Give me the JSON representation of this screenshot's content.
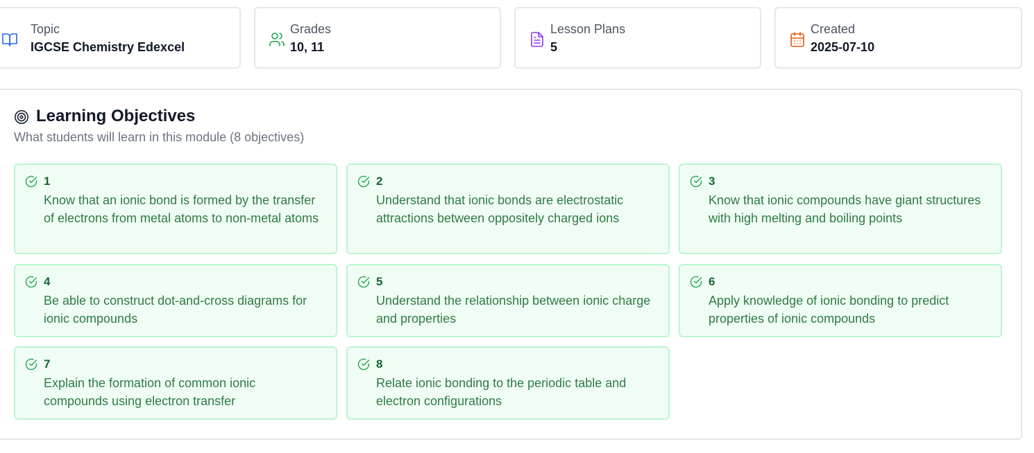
{
  "stats": [
    {
      "label": "Topic",
      "value": "IGCSE Chemistry Edexcel",
      "icon": "book-open-icon",
      "color": "#2563eb"
    },
    {
      "label": "Grades",
      "value": "10, 11",
      "icon": "users-icon",
      "color": "#16a34a"
    },
    {
      "label": "Lesson Plans",
      "value": "5",
      "icon": "file-text-icon",
      "color": "#9333ea"
    },
    {
      "label": "Created",
      "value": "2025-07-10",
      "icon": "calendar-icon",
      "color": "#ea580c"
    }
  ],
  "objectives": {
    "title": "Learning Objectives",
    "subtitle": "What students will learn in this module (8 objectives)",
    "icon": "target-icon",
    "items": [
      {
        "number": "1",
        "text": "Know that an ionic bond is formed by the transfer of electrons from metal atoms to non-metal atoms"
      },
      {
        "number": "2",
        "text": "Understand that ionic bonds are electrostatic attractions between oppositely charged ions"
      },
      {
        "number": "3",
        "text": "Know that ionic compounds have giant structures with high melting and boiling points"
      },
      {
        "number": "4",
        "text": "Be able to construct dot-and-cross diagrams for ionic compounds"
      },
      {
        "number": "5",
        "text": "Understand the relationship between ionic charge and properties"
      },
      {
        "number": "6",
        "text": "Apply knowledge of ionic bonding to predict properties of ionic compounds"
      },
      {
        "number": "7",
        "text": "Explain the formation of common ionic compounds using electron transfer"
      },
      {
        "number": "8",
        "text": "Relate ionic bonding to the periodic table and electron configurations"
      }
    ]
  }
}
